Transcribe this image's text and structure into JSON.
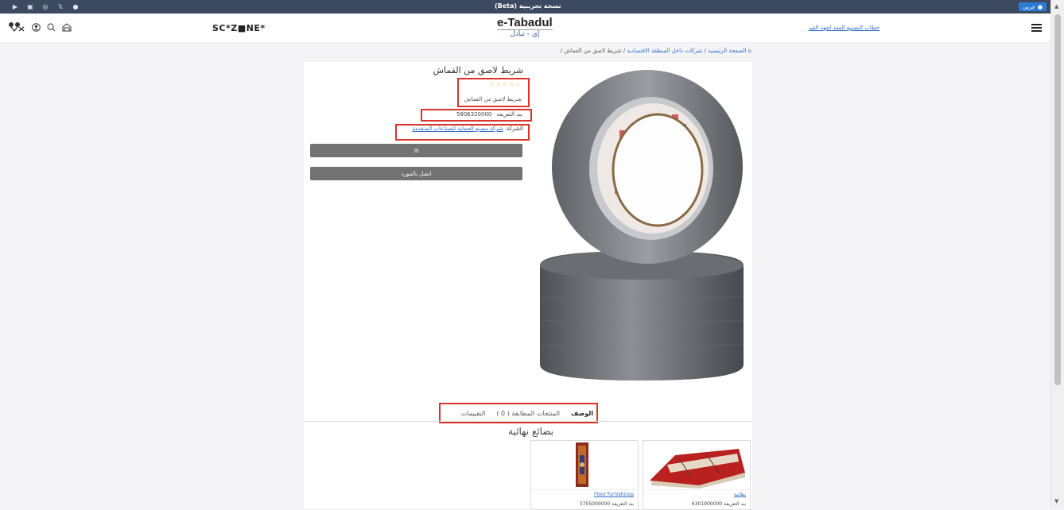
{
  "topbar": {
    "social_icons": [
      "youtube-icon",
      "linkedin-icon",
      "instagram-icon",
      "x-icon",
      "facebook-icon"
    ],
    "beta_text": "نسخة تجريبية (Beta)",
    "language": "عربي"
  },
  "header": {
    "icons": [
      "compare-icon",
      "user-icon",
      "search-icon",
      "mailbox-icon"
    ],
    "sczone": "SC*Z■NE*",
    "logo_line1": "e-Tabadul",
    "logo_line2": "إي - تبادل",
    "company_link": "خطاب التصنيع المعد لجهة الغير"
  },
  "breadcrumb": {
    "home": "الصفحة الرئيسية",
    "sep1": "/",
    "category": "شركات داخل المنطقة الاقتصادية",
    "sep2": "/",
    "current": "شريط لاصق من القماش",
    "sep3": "/"
  },
  "product": {
    "title": "شريط لاصق من القماش",
    "stars": "☆☆☆☆☆",
    "description": "شريط لاصق من القماش",
    "tariff_label": "بند التعريفة",
    "tariff_value": "5806320000",
    "company_label": "الشركة",
    "company_name": "شركة مصنع الحماية للصناعات المتقدمة",
    "email_icon": "envelope-icon",
    "contact_button": "اتصل بالمورد"
  },
  "tabs": {
    "description": "الوصف",
    "matching": "المنتجات المطابقة ( 0 )",
    "reviews": "التقييمات"
  },
  "section": {
    "title": "بضائع نهائية"
  },
  "cards": [
    {
      "name": "بطانية",
      "code_label": "بند التعريفة",
      "code": "6301900000"
    },
    {
      "name": "Floor furnishings",
      "code_label": "بند التعريفة",
      "code": "5705000000"
    }
  ],
  "colors": {
    "topbar": "#3b4a60",
    "highlight": "#d9332b",
    "link": "#2e6bc7",
    "button": "#727272"
  }
}
